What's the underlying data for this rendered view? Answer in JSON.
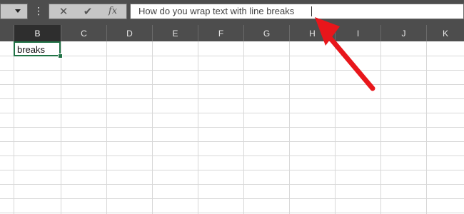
{
  "formula_bar": {
    "namebox_arrow_icon": "chevron-down-icon",
    "dots_label": "⋮",
    "cancel_label": "✕",
    "enter_label": "✔",
    "fx_label": "fx",
    "formula_text": "How do you wrap text with line breaks"
  },
  "columns": [
    "B",
    "C",
    "D",
    "E",
    "F",
    "G",
    "H",
    "I",
    "J",
    "K"
  ],
  "selected_column": "B",
  "active_cell": {
    "value": "breaks"
  },
  "annotation": {
    "arrow_color": "#e8161b"
  },
  "colors": {
    "chrome": "#4d4d4d",
    "selection": "#217346"
  }
}
